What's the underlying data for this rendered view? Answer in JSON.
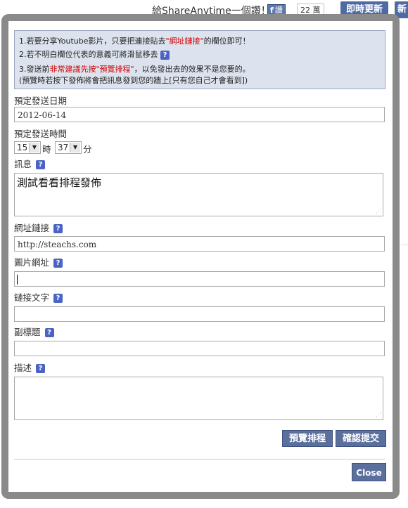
{
  "topbar": {
    "share_text": "給ShareAnytime一個讚！",
    "fb_like_label": "讚",
    "fb_icon": "f",
    "fb_count": "22 萬",
    "instant_update_label": "即時更新",
    "new_label": "新"
  },
  "notice": {
    "line1_a": "1.若要分享Youtube影片，只要把連接貼去",
    "line1_red": "\"網址鏈接\"",
    "line1_b": "的欄位即可！",
    "line2": "2.若不明白欄位代表的意義可將滑鼠移去",
    "line3_a": "3.發送前",
    "line3_red": "非常建議先按\"預覽排程\"",
    "line3_b": "，以免發出去的效果不是您要的。",
    "line4": "(預覽時若按下發佈將會把訊息發到您的牆上[只有您自己才會看到])"
  },
  "help_icon_glyph": "?",
  "form": {
    "date_label": "預定發送日期",
    "date_value": "2012-06-14",
    "time_label": "預定發送時間",
    "hour_value": "15",
    "hour_unit": "時",
    "minute_value": "37",
    "minute_unit": "分",
    "message_label": "訊息",
    "message_value": "測試看看排程發佈",
    "url_label": "網址鏈接",
    "url_value": "http://steachs.com",
    "image_label": "圖片網址",
    "image_value": "",
    "link_text_label": "鏈接文字",
    "link_text_value": "",
    "subtitle_label": "副標題",
    "subtitle_value": "",
    "description_label": "描述",
    "description_value": ""
  },
  "buttons": {
    "preview": "預覽排程",
    "submit": "確認提交",
    "close": "Close"
  },
  "colors": {
    "accent": "#5b6f9d",
    "notice_bg": "#dde3ee",
    "highlight_red": "#d10000",
    "help_icon": "#4b64c4"
  }
}
